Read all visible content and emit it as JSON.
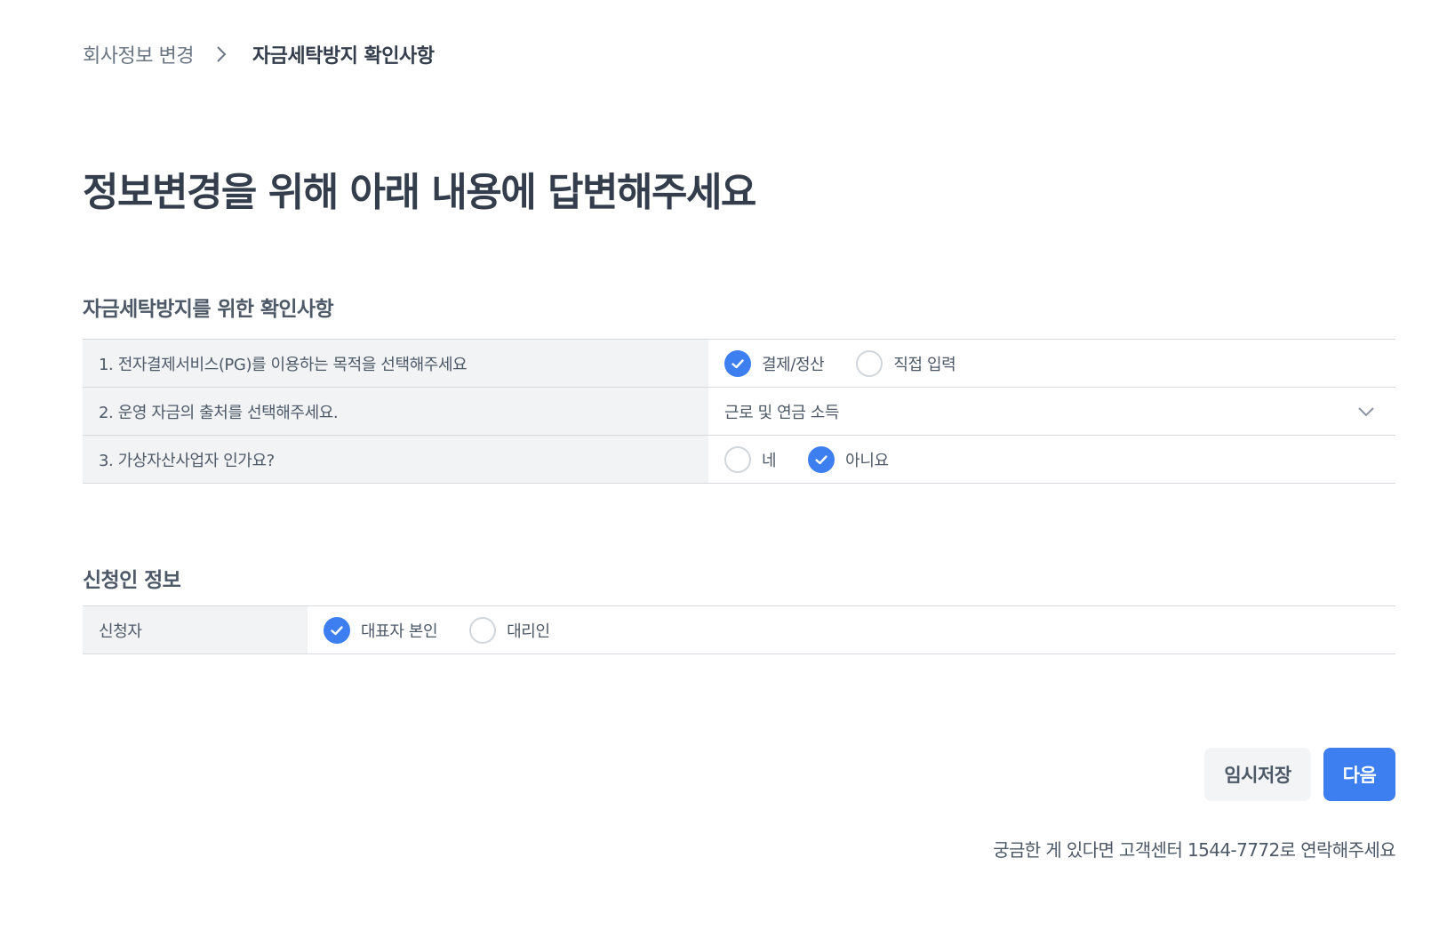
{
  "breadcrumb": {
    "parent": "회사정보 변경",
    "current": "자금세탁방지 확인사항"
  },
  "page_title": "정보변경을 위해 아래 내용에 답변해주세요",
  "aml_section": {
    "title": "자금세탁방지를 위한 확인사항",
    "q1": {
      "label": "1. 전자결제서비스(PG)를 이용하는 목적을 선택해주세요",
      "options": [
        {
          "label": "결제/정산",
          "checked": true
        },
        {
          "label": "직접 입력",
          "checked": false
        }
      ]
    },
    "q2": {
      "label": "2. 운영 자금의 출처를 선택해주세요.",
      "selected": "근로 및 연금 소득"
    },
    "q3": {
      "label": "3. 가상자산사업자 인가요?",
      "options": [
        {
          "label": "네",
          "checked": false
        },
        {
          "label": "아니요",
          "checked": true
        }
      ]
    }
  },
  "applicant_section": {
    "title": "신청인 정보",
    "applicant": {
      "label": "신청자",
      "options": [
        {
          "label": "대표자 본인",
          "checked": true
        },
        {
          "label": "대리인",
          "checked": false
        }
      ]
    }
  },
  "buttons": {
    "temp_save": "임시저장",
    "next": "다음"
  },
  "help_text": "궁금한 게 있다면 고객센터 1544-7772로 연락해주세요",
  "colors": {
    "accent": "#3d7ef0",
    "label_bg": "#f2f3f5",
    "border": "#d6d9de"
  }
}
